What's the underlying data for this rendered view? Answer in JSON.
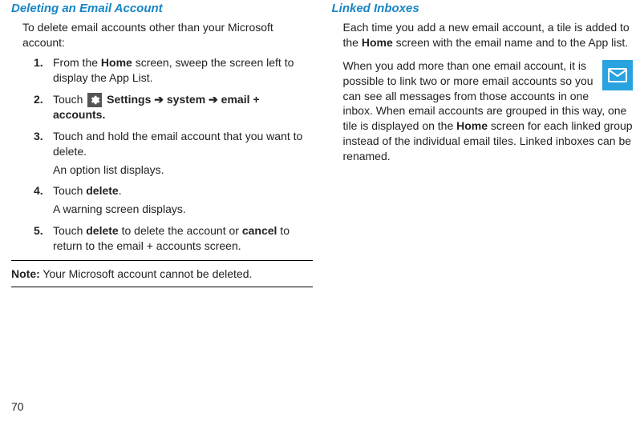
{
  "page_number": "70",
  "left": {
    "title": "Deleting an Email Account",
    "intro": "To delete email accounts other than your Microsoft account:",
    "steps": [
      {
        "pre": "From the ",
        "b1": "Home",
        "post": " screen, sweep the screen left to display the App List."
      },
      {
        "pre": "Touch ",
        "icon": "settings",
        "b1": "Settings",
        "arrow1": " ➔ ",
        "b2": "system",
        "arrow2": " ➔ ",
        "b3": "email + accounts."
      },
      {
        "pre": "Touch and hold the email account that you want to delete.",
        "sub": "An option list displays."
      },
      {
        "pre": "Touch ",
        "b1": "delete",
        "post": ".",
        "sub": "A warning screen displays."
      },
      {
        "pre": "Touch ",
        "b1": "delete",
        "mid": " to delete the account or ",
        "b2": "cancel",
        "post": " to return to the email + accounts screen."
      }
    ],
    "note_label": "Note:",
    "note_text": " Your Microsoft account cannot be deleted."
  },
  "right": {
    "title": "Linked Inboxes",
    "p1_pre": "Each time you add a new email account, a tile is added to the ",
    "p1_b": "Home",
    "p1_post": " screen with the email name and to the App list.",
    "p2_pre": "When you add more than one email account, it is possible to link two or more email accounts so you can see all messages from those accounts in one inbox. When email accounts are grouped in this way, one tile is displayed on the ",
    "p2_b": "Home",
    "p2_post": " screen for each linked group instead of the individual email tiles. Linked inboxes can be renamed."
  }
}
